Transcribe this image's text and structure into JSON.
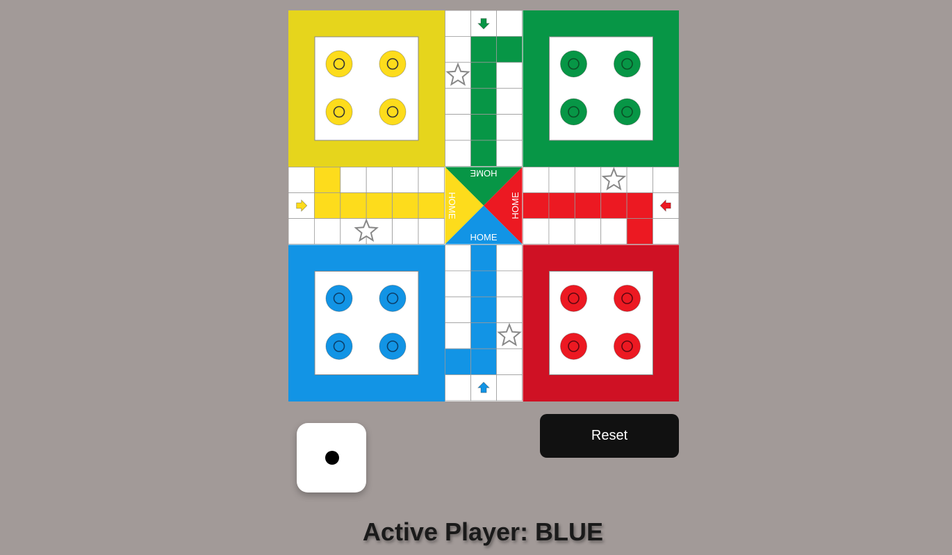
{
  "board": {
    "colors": {
      "yellow": "#e6d51c",
      "yellow_track": "#fddc1c",
      "green": "#079646",
      "red": "#cf1124",
      "red_track": "#ec1922",
      "blue": "#1294e5",
      "white": "#ffffff",
      "grid": "#9a9a9a"
    },
    "home_labels": {
      "top": "HOME",
      "left": "HOME",
      "right": "HOME",
      "bottom": "HOME"
    },
    "yards": [
      {
        "player": "yellow",
        "tokens": 4
      },
      {
        "player": "green",
        "tokens": 4
      },
      {
        "player": "blue",
        "tokens": 4
      },
      {
        "player": "red",
        "tokens": 4
      }
    ],
    "start_arrows": [
      "green-down-icon",
      "yellow-right-icon",
      "red-left-icon",
      "blue-up-icon"
    ],
    "safe_stars": 4
  },
  "dice": {
    "value": 1
  },
  "controls": {
    "reset_label": "Reset"
  },
  "status": {
    "prefix": "Active Player: ",
    "player": "BLUE",
    "text": "Active Player: BLUE"
  }
}
